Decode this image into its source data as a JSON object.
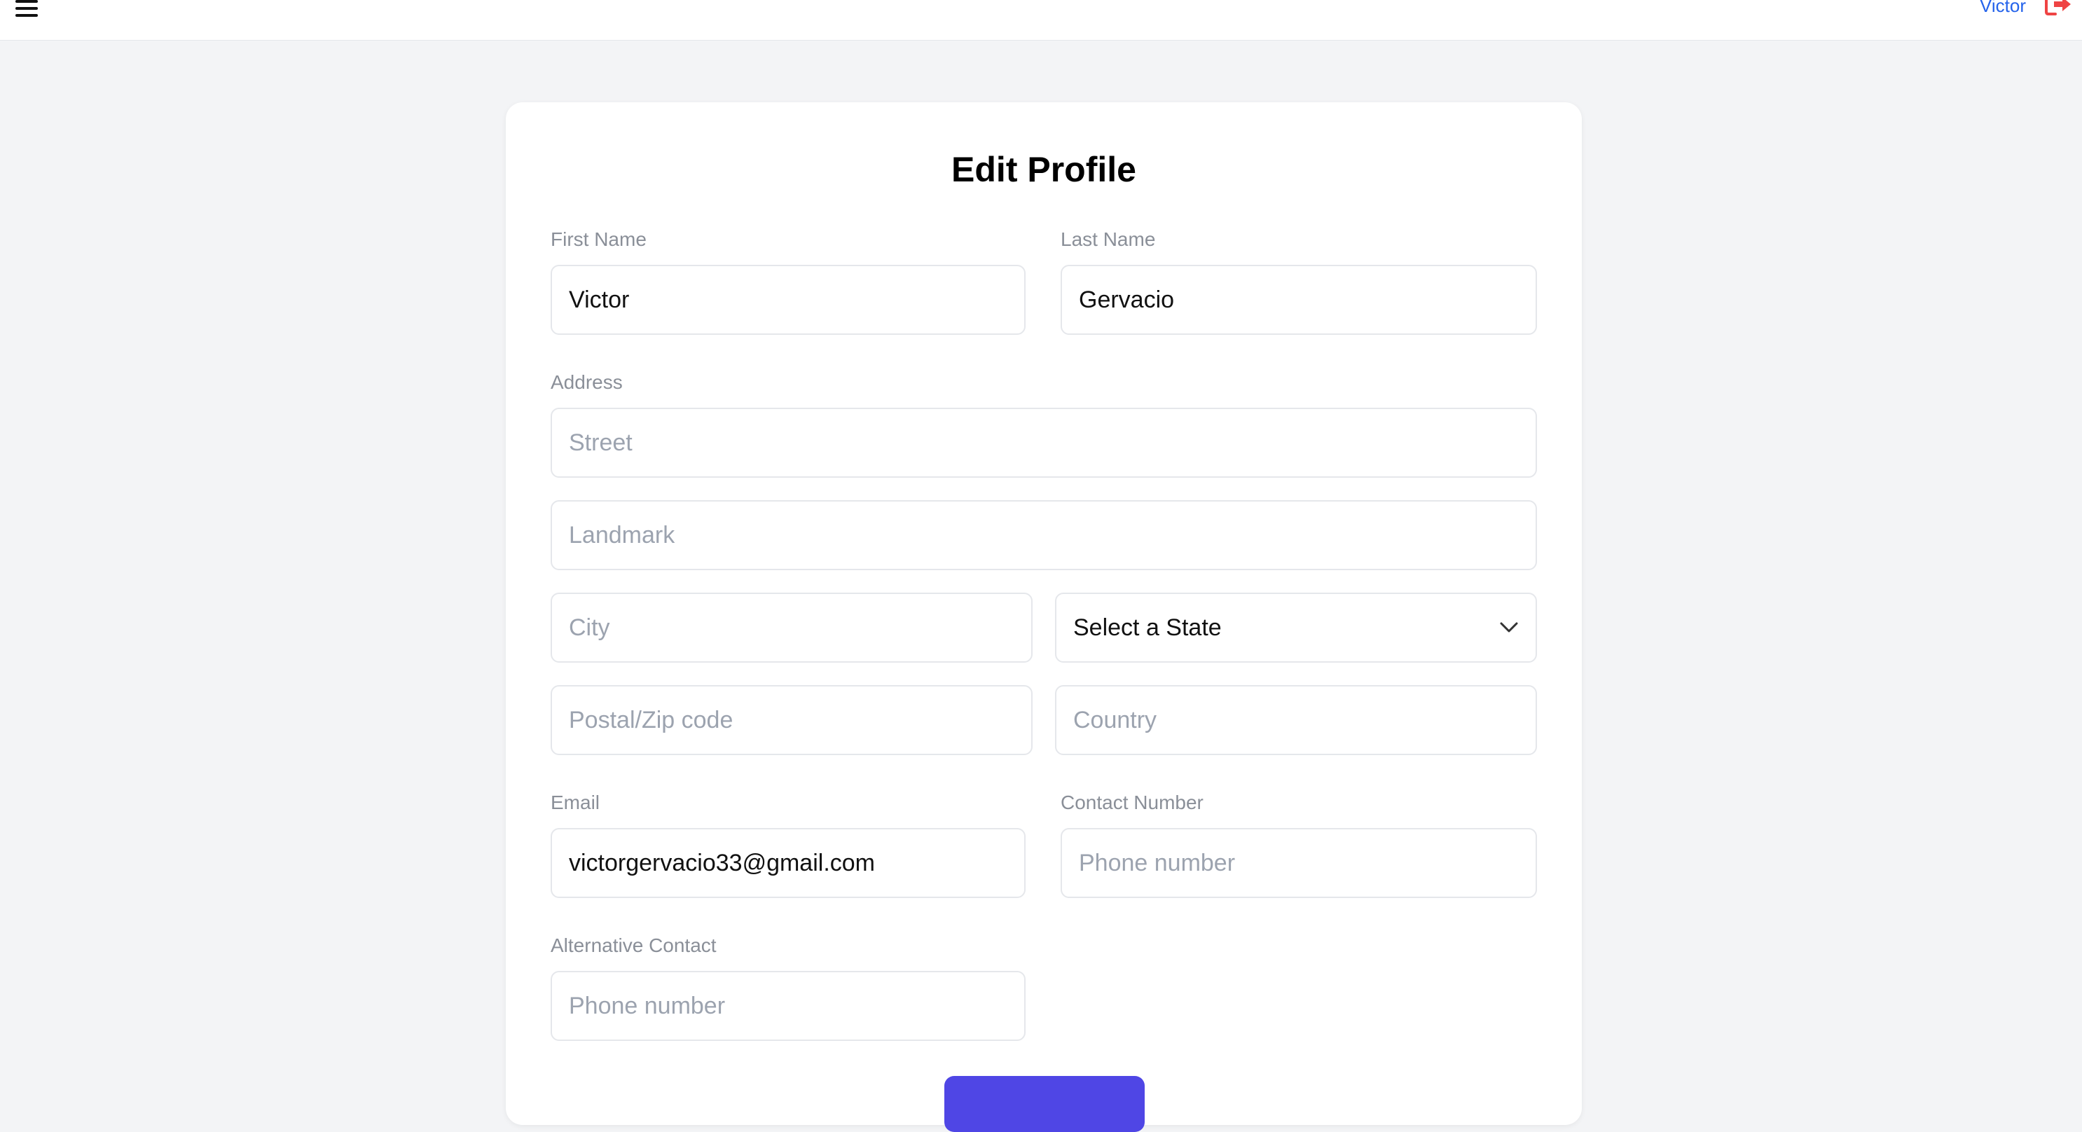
{
  "topbar": {
    "menu_icon": "hamburger-icon",
    "user_name": "Victor",
    "logout_icon": "logout-icon",
    "logout_color": "#ef4444",
    "user_color": "#2563eb"
  },
  "form": {
    "title": "Edit Profile",
    "first_name": {
      "label": "First Name",
      "value": "Victor"
    },
    "last_name": {
      "label": "Last Name",
      "value": "Gervacio"
    },
    "address": {
      "label": "Address",
      "street_placeholder": "Street",
      "landmark_placeholder": "Landmark",
      "city_placeholder": "City",
      "state_selected": "Select a State",
      "postal_placeholder": "Postal/Zip code",
      "country_placeholder": "Country"
    },
    "email": {
      "label": "Email",
      "value": "victorgervacio33@gmail.com"
    },
    "contact": {
      "label": "Contact Number",
      "placeholder": "Phone number"
    },
    "alt_contact": {
      "label": "Alternative Contact",
      "placeholder": "Phone number"
    },
    "submit_color": "#4f46e5"
  }
}
